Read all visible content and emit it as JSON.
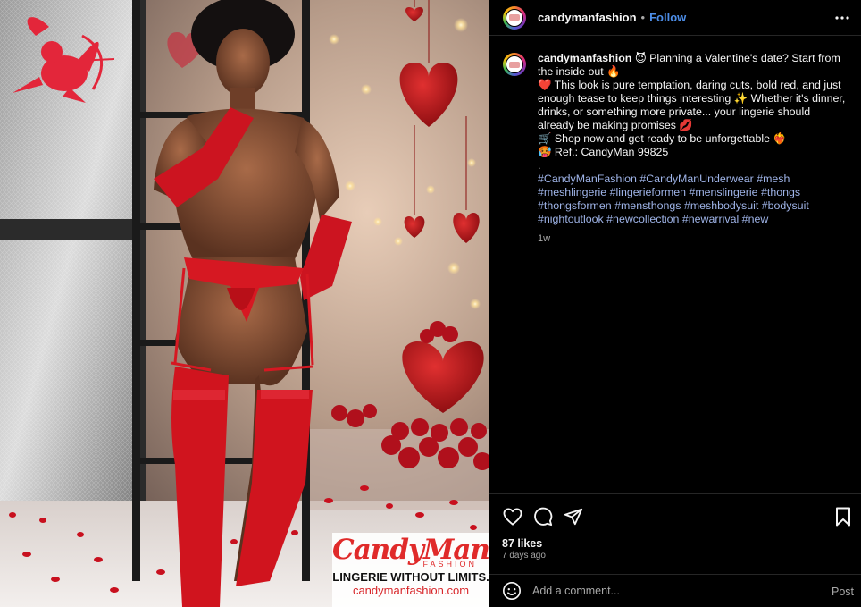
{
  "colors": {
    "accent_blue": "#4d8ee8",
    "hashtag_blue": "#9fb4e8",
    "brand_red": "#e02a2a",
    "background": "#000000"
  },
  "header": {
    "username": "candymanfashion",
    "separator": "•",
    "follow_label": "Follow",
    "more_icon": "more-horizontal-icon"
  },
  "caption": {
    "username": "candymanfashion",
    "lines": [
      "😈 Planning a Valentine's date? Start from the inside out 🔥",
      "❤️ This look is pure temptation, daring cuts, bold red, and just enough tease to keep things interesting ✨ Whether it's dinner, drinks, or something more private... your lingerie should already be making promises 💋",
      "🛒 Shop now and get ready to be unforgettable ❤️‍🔥",
      "🥵 Ref.: CandyMan 99825",
      "."
    ],
    "hashtags": "#CandyManFashion #CandyManUnderwear #mesh #meshlingerie #lingerieformen #menslingerie #thongs #thongsformen #mensthongs #meshbodysuit #bodysuit #nightoutlook #newcollection #newarrival #new",
    "time": "1w"
  },
  "actions": {
    "icons": [
      "heart-icon",
      "comment-icon",
      "share-icon",
      "bookmark-icon"
    ]
  },
  "likes": "87 likes",
  "posted": "7 days ago",
  "comment_box": {
    "placeholder": "Add a comment...",
    "post_label": "Post"
  },
  "media": {
    "brand_name": "CandyMan",
    "brand_sub": "FASHION",
    "tagline": "LINGERIE WITHOUT LIMITS.",
    "url": "candymanfashion.com"
  }
}
